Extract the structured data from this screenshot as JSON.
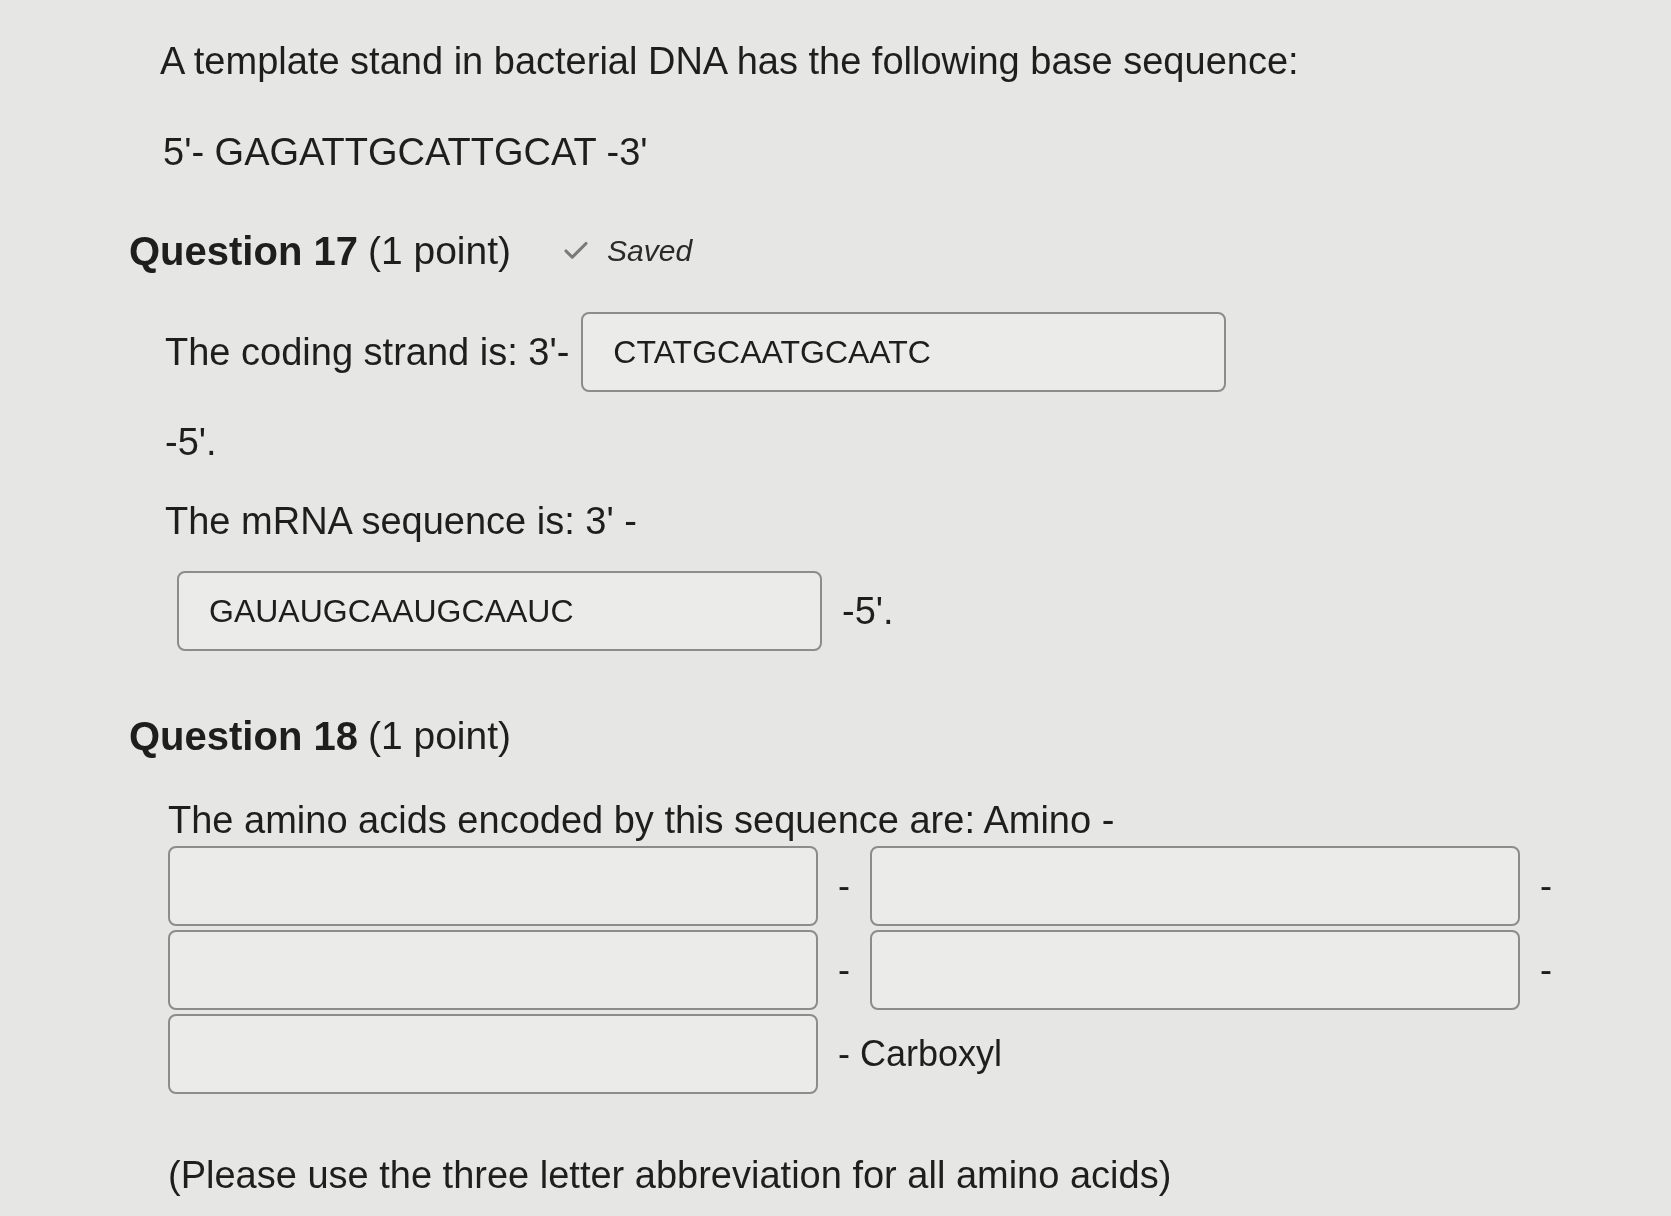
{
  "intro": {
    "text": "A template stand in bacterial DNA has the following base sequence:",
    "sequence": "5'- GAGATTGCATTGCAT -3'"
  },
  "questions": [
    {
      "title": "Question 17",
      "points": "(1 point)",
      "status": {
        "saved": true,
        "label": "Saved"
      },
      "blanks": [
        {
          "prefix": "The coding strand is: 3'-",
          "value": "CTATGCAATGCAATC",
          "suffix": "-5'."
        },
        {
          "prefix": "The mRNA sequence is: 3' -",
          "value": "GAUAUGCAAUGCAAUC",
          "suffix": "-5'."
        }
      ]
    },
    {
      "title": "Question 18",
      "points": "(1 point)",
      "prompt": "The amino acids encoded by this sequence are: Amino -",
      "answers": [
        {
          "separator": "-"
        },
        {
          "separator": "-"
        },
        {
          "separator": "-"
        },
        {
          "separator": "-"
        },
        {
          "separator": "- Carboxyl"
        }
      ],
      "note": "(Please use the three letter abbreviation for all amino acids)"
    }
  ]
}
